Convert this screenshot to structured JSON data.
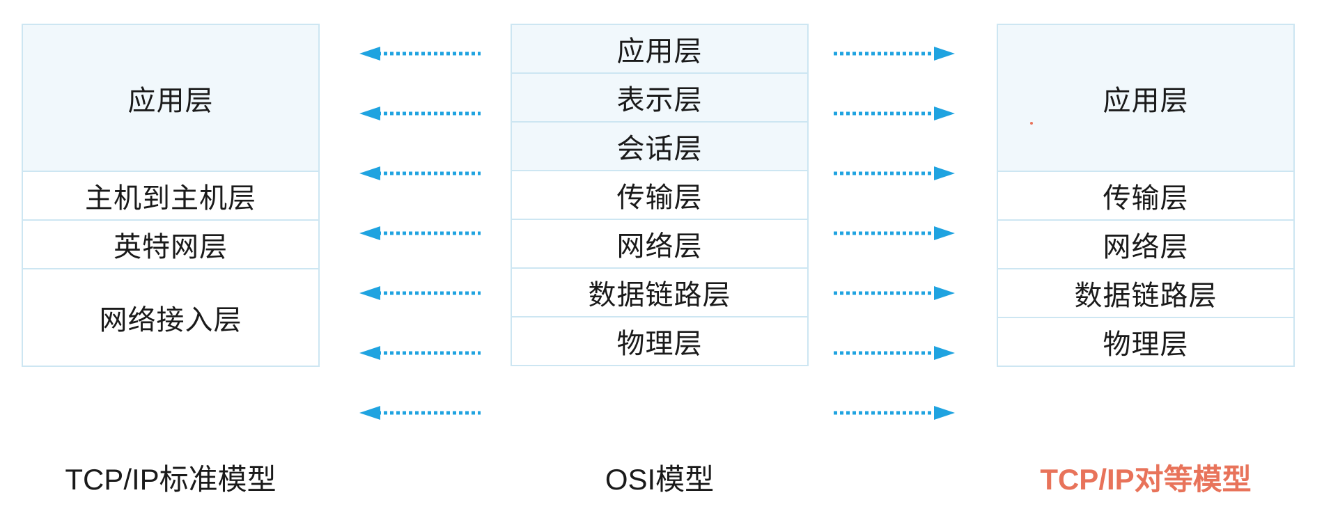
{
  "left_model": {
    "caption": "TCP/IP标准模型",
    "layers": [
      {
        "label": "应用层",
        "spans": 3
      },
      {
        "label": "主机到主机层",
        "spans": 1
      },
      {
        "label": "英特网层",
        "spans": 1
      },
      {
        "label": "网络接入层",
        "spans": 2
      }
    ]
  },
  "osi_model": {
    "caption": "OSI模型",
    "layers": [
      {
        "label": "应用层",
        "spans": 1
      },
      {
        "label": "表示层",
        "spans": 1
      },
      {
        "label": "会话层",
        "spans": 1
      },
      {
        "label": "传输层",
        "spans": 1
      },
      {
        "label": "网络层",
        "spans": 1
      },
      {
        "label": "数据链路层",
        "spans": 1
      },
      {
        "label": "物理层",
        "spans": 1
      }
    ]
  },
  "right_model": {
    "caption": "TCP/IP对等模型",
    "layers": [
      {
        "label": "应用层",
        "spans": 3
      },
      {
        "label": "传输层",
        "spans": 1
      },
      {
        "label": "网络层",
        "spans": 1
      },
      {
        "label": "数据链路层",
        "spans": 1
      },
      {
        "label": "物理层",
        "spans": 1
      }
    ]
  },
  "arrows": {
    "count_per_side": 7,
    "left_direction": "left",
    "right_direction": "right"
  },
  "colors": {
    "arrow": "#1fa3e0",
    "border": "#cde6f2",
    "tint": "#f1f8fc",
    "right_caption": "#e8735a",
    "stray_dot": "#e8735a"
  }
}
